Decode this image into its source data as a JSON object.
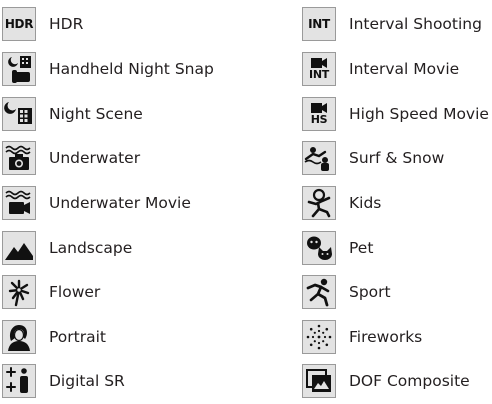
{
  "left_column": [
    {
      "icon": "hdr-icon",
      "icon_text": "HDR",
      "label": "HDR"
    },
    {
      "icon": "handheld-night-snap-icon",
      "label": "Handheld Night Snap"
    },
    {
      "icon": "night-scene-icon",
      "label": "Night Scene"
    },
    {
      "icon": "underwater-icon",
      "label": "Underwater"
    },
    {
      "icon": "underwater-movie-icon",
      "label": "Underwater Movie"
    },
    {
      "icon": "landscape-icon",
      "label": "Landscape"
    },
    {
      "icon": "flower-icon",
      "label": "Flower"
    },
    {
      "icon": "portrait-icon",
      "label": "Portrait"
    },
    {
      "icon": "digital-sr-icon",
      "label": "Digital SR"
    }
  ],
  "right_column": [
    {
      "icon": "interval-shooting-icon",
      "icon_text": "INT",
      "label": "Interval Shooting"
    },
    {
      "icon": "interval-movie-icon",
      "icon_text": "INT",
      "label": "Interval Movie"
    },
    {
      "icon": "high-speed-movie-icon",
      "icon_text": "HS",
      "label": "High Speed Movie"
    },
    {
      "icon": "surf-and-snow-icon",
      "label": "Surf & Snow"
    },
    {
      "icon": "kids-icon",
      "label": "Kids"
    },
    {
      "icon": "pet-icon",
      "label": "Pet"
    },
    {
      "icon": "sport-icon",
      "label": "Sport"
    },
    {
      "icon": "fireworks-icon",
      "label": "Fireworks"
    },
    {
      "icon": "dof-composite-icon",
      "label": "DOF Composite"
    }
  ]
}
